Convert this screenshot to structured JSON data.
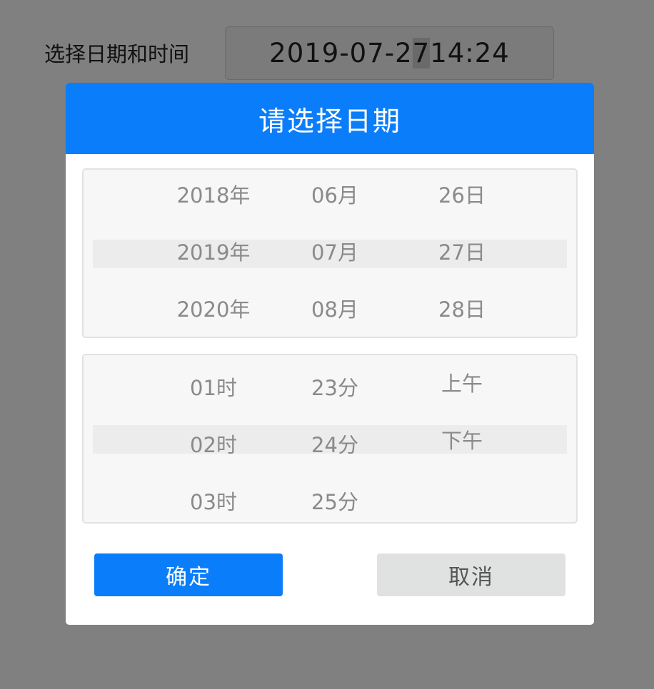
{
  "form": {
    "label": "选择日期和时间",
    "value_before_caret": "2019-07-2",
    "value_caret_char": "7",
    "value_after_caret": " 14:24"
  },
  "dialog": {
    "title": "请选择日期",
    "date_wheel": {
      "years": [
        "2018年",
        "2019年",
        "2020年"
      ],
      "months": [
        "06月",
        "07月",
        "08月"
      ],
      "days": [
        "26日",
        "27日",
        "28日"
      ],
      "selected": {
        "year": "2019年",
        "month": "07月",
        "day": "27日"
      }
    },
    "time_wheel": {
      "hours": [
        "01时",
        "02时",
        "03时"
      ],
      "minutes": [
        "23分",
        "24分",
        "25分"
      ],
      "periods": [
        "上午",
        "下午"
      ],
      "selected": {
        "hour": "02时",
        "minute": "24分",
        "period": "下午"
      }
    },
    "confirm_label": "确定",
    "cancel_label": "取消"
  },
  "colors": {
    "overlay": "#808080",
    "accent": "#0a7dfa",
    "cancel_bg": "#e0e1e1",
    "wheel_text": "#8a8a8a"
  }
}
